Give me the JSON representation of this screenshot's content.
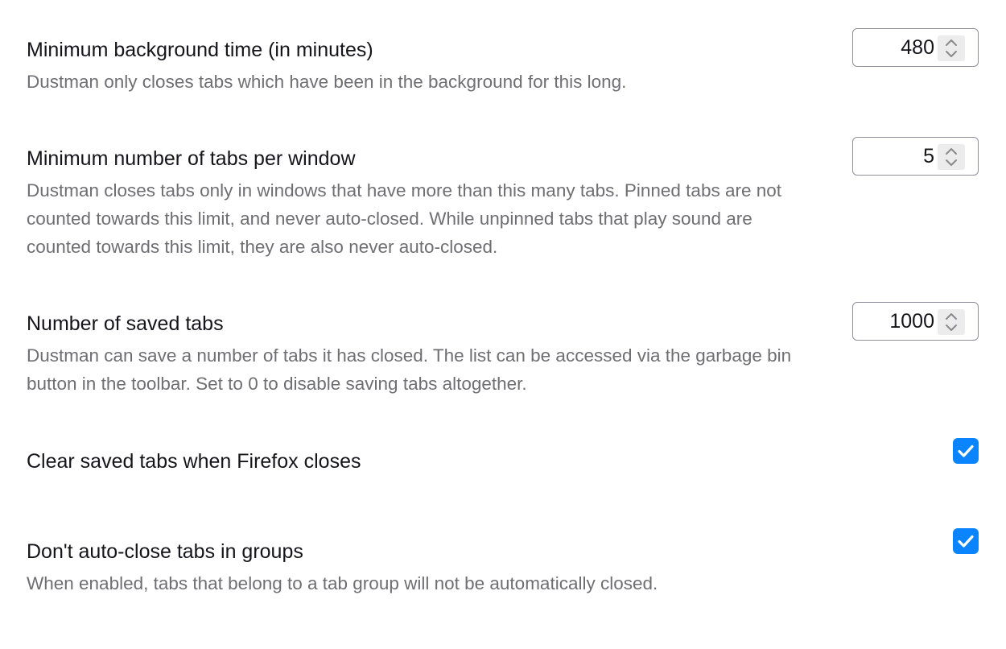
{
  "settings": {
    "background_time": {
      "title": "Minimum background time (in minutes)",
      "description": "Dustman only closes tabs which have been in the background for this long.",
      "value": "480"
    },
    "min_tabs": {
      "title": "Minimum number of tabs per window",
      "description": "Dustman closes tabs only in windows that have more than this many tabs. Pinned tabs are not counted towards this limit, and never auto-closed. While unpinned tabs that play sound are counted towards this limit, they are also never auto-closed.",
      "value": "5"
    },
    "saved_tabs": {
      "title": "Number of saved tabs",
      "description": "Dustman can save a number of tabs it has closed. The list can be accessed via the garbage bin button in the toolbar. Set to 0 to disable saving tabs altogether.",
      "value": "1000"
    },
    "clear_on_close": {
      "title": "Clear saved tabs when Firefox closes",
      "checked": true
    },
    "groups": {
      "title": "Don't auto-close tabs in groups",
      "description": "When enabled, tabs that belong to a tab group will not be automatically closed.",
      "checked": true
    }
  },
  "colors": {
    "checkbox_accent": "#0a84ff",
    "description_text": "#6e6e73"
  },
  "icons": {
    "spinner": "up-down-chevron-icon",
    "checkbox": "checkmark-icon"
  }
}
